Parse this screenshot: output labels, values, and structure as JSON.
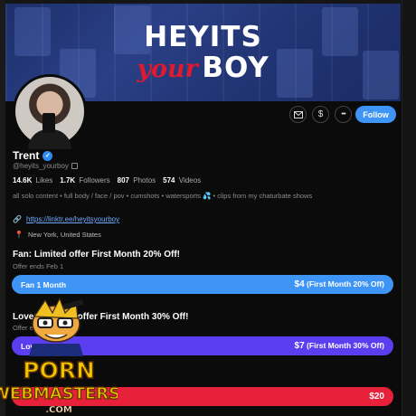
{
  "banner": {
    "line1": "HEYITS",
    "line2_script": "your",
    "line2_bold": "BOY"
  },
  "actions": {
    "message_icon": "envelope-icon",
    "tip_label": "$",
    "more_label": "•••",
    "follow_label": "Follow"
  },
  "profile": {
    "name": "Trent",
    "handle": "@heyits_yourboy",
    "stats": [
      {
        "value": "14.6K",
        "label": "Likes"
      },
      {
        "value": "1.7K",
        "label": "Followers"
      },
      {
        "value": "807",
        "label": "Photos"
      },
      {
        "value": "574",
        "label": "Videos"
      }
    ],
    "bio": "all solo content • full body / face / pov • cumshots • watersports 💦 • clips from my chaturbate shows",
    "link": "https://linktr.ee/heyitsyourboy",
    "location": "New York, United States"
  },
  "offers": [
    {
      "title": "Fan: Limited offer First Month 20% Off!",
      "subtitle": "Offer ends Feb 1",
      "button_label": "Fan 1 Month",
      "price": "$4",
      "price_note": "(First Month 20% Off)",
      "color": "#3f95f5"
    },
    {
      "title": "Lover: Limited offer First Month 30% Off!",
      "subtitle": "Offer ends Feb 1",
      "button_label": "Lover 1 Month",
      "price": "$7",
      "price_note": "(First Month 30% Off)",
      "color": "#5a3ef0"
    },
    {
      "title": "",
      "subtitle": "",
      "button_label": "",
      "price": "$20",
      "price_note": "",
      "color": "#e8213a"
    }
  ],
  "watermark": {
    "line1": "PORN",
    "line2": "WEBMASTERS",
    "line3": ".COM"
  }
}
